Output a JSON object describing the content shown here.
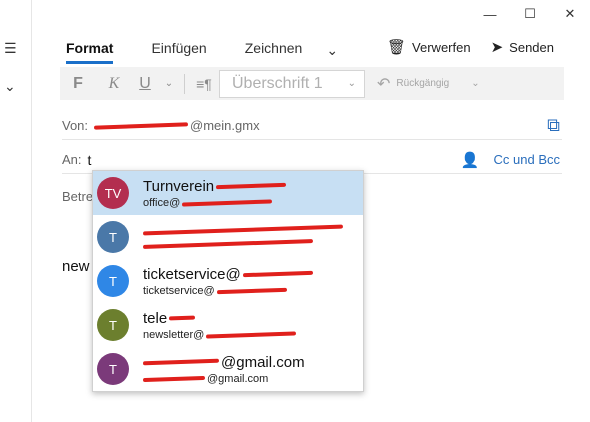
{
  "window": {
    "minimize": "—",
    "maximize": "☐",
    "close": "✕"
  },
  "left_nav": {
    "icon_top": "☰",
    "icon_chevron": "⌄"
  },
  "ribbon": {
    "tabs": [
      {
        "label": "Format",
        "active": true
      },
      {
        "label": "Einfügen",
        "active": false
      },
      {
        "label": "Zeichnen",
        "active": false
      }
    ],
    "more_chevron": "⌄",
    "discard_label": "Verwerfen",
    "send_label": "Senden"
  },
  "toolbar": {
    "bold": "F",
    "italic": "K",
    "underline": "U",
    "paragraph_style": "Überschrift 1",
    "undo_label": "Rückgängig"
  },
  "compose": {
    "from_label": "Von:",
    "from_domain": "@mein.gmx",
    "to_label": "An:",
    "to_value": "t",
    "cc_bcc_label": "Cc und Bcc",
    "subject_label": "Betre",
    "body_text": "new"
  },
  "suggestions": [
    {
      "initials": "TV",
      "color": "#b32e4f",
      "name": "Turnverein",
      "email": "office@",
      "selected": true
    },
    {
      "initials": "T",
      "color": "#4a78a8",
      "name": "",
      "email": "",
      "selected": false
    },
    {
      "initials": "T",
      "color": "#2f87e6",
      "name": "ticketservice@",
      "email": "ticketservice@",
      "selected": false
    },
    {
      "initials": "T",
      "color": "#6c7f2e",
      "name": "tele",
      "email": "newsletter@",
      "selected": false
    },
    {
      "initials": "T",
      "color": "#7b3a7a",
      "name": "@gmail.com",
      "email": "@gmail.com",
      "selected": false
    }
  ]
}
